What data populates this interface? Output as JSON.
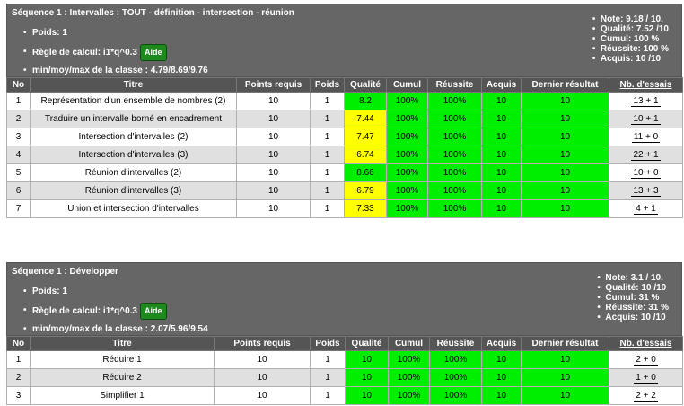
{
  "table_headers": {
    "no": "No",
    "titre": "Titre",
    "points_requis": "Points requis",
    "poids": "Poids",
    "qualite": "Qualité",
    "cumul": "Cumul",
    "reussite": "Réussite",
    "acquis": "Acquis",
    "dernier_resultat": "Dernier résultat",
    "nb_essais": "Nb. d'essais"
  },
  "sections": [
    {
      "title": "Séquence 1  : Intervalles : TOUT - définition - intersection - réunion",
      "poids_label": "Poids: 1",
      "regle_label": "Règle de calcul: i1*q^0.3",
      "aide_label": "Aide",
      "minmax_label": "min/moy/max de la classe : 4.79/8.69/9.76",
      "stats": {
        "note": "Note: 9.18 / 10.",
        "qualite": "Qualité: 7.52 /10",
        "cumul": "Cumul: 100 %",
        "reussite": "Réussite: 100 %",
        "acquis": "Acquis: 10 /10"
      },
      "rows": [
        {
          "no": "1",
          "titre": "Représentation d'un ensemble de nombres (2)",
          "points": "10",
          "poids": "1",
          "qualite": "8.2",
          "qcolor": "#00ee00",
          "cumul": "100%",
          "reussite": "100%",
          "acquis": "10",
          "dernier": "10",
          "essais": "13 + 1"
        },
        {
          "no": "2",
          "titre": "Traduire un intervalle borné en encadrement",
          "points": "10",
          "poids": "1",
          "qualite": "7.44",
          "qcolor": "#ffff00",
          "cumul": "100%",
          "reussite": "100%",
          "acquis": "10",
          "dernier": "10",
          "essais": "10 + 1"
        },
        {
          "no": "3",
          "titre": "Intersection d'intervalles (2)",
          "points": "10",
          "poids": "1",
          "qualite": "7.47",
          "qcolor": "#ffff00",
          "cumul": "100%",
          "reussite": "100%",
          "acquis": "10",
          "dernier": "10",
          "essais": "11 + 0"
        },
        {
          "no": "4",
          "titre": "Intersection d'intervalles (3)",
          "points": "10",
          "poids": "1",
          "qualite": "6.74",
          "qcolor": "#ffff00",
          "cumul": "100%",
          "reussite": "100%",
          "acquis": "10",
          "dernier": "10",
          "essais": "22 + 1"
        },
        {
          "no": "5",
          "titre": "Réunion d'intervalles (2)",
          "points": "10",
          "poids": "1",
          "qualite": "8.66",
          "qcolor": "#00ee00",
          "cumul": "100%",
          "reussite": "100%",
          "acquis": "10",
          "dernier": "10",
          "essais": "10 + 0"
        },
        {
          "no": "6",
          "titre": "Réunion d'intervalles (3)",
          "points": "10",
          "poids": "1",
          "qualite": "6.79",
          "qcolor": "#ffff00",
          "cumul": "100%",
          "reussite": "100%",
          "acquis": "10",
          "dernier": "10",
          "essais": "13 + 3"
        },
        {
          "no": "7",
          "titre": "Union et intersection d'intervalles",
          "points": "10",
          "poids": "1",
          "qualite": "7.33",
          "qcolor": "#ffff00",
          "cumul": "100%",
          "reussite": "100%",
          "acquis": "10",
          "dernier": "10",
          "essais": "4 + 1"
        }
      ]
    },
    {
      "title": "Séquence 1  : Développer",
      "poids_label": "Poids: 1",
      "regle_label": "Règle de calcul: i1*q^0.3",
      "aide_label": "Aide",
      "minmax_label": "min/moy/max de la classe : 2.07/5.96/9.54",
      "stats": {
        "note": "Note: 3.1 / 10.",
        "qualite": "Qualité: 10 /10",
        "cumul": "Cumul: 31 %",
        "reussite": "Réussite: 31 %",
        "acquis": "Acquis: 10 /10"
      },
      "rows": [
        {
          "no": "1",
          "titre": "Réduire 1",
          "points": "10",
          "poids": "1",
          "qualite": "10",
          "qcolor": "#00ee00",
          "cumul": "100%",
          "reussite": "100%",
          "acquis": "10",
          "dernier": "10",
          "essais": "2 + 0"
        },
        {
          "no": "2",
          "titre": "Réduire 2",
          "points": "10",
          "poids": "1",
          "qualite": "10",
          "qcolor": "#00ee00",
          "cumul": "100%",
          "reussite": "100%",
          "acquis": "10",
          "dernier": "10",
          "essais": "1 + 0"
        },
        {
          "no": "3",
          "titre": "Simplifier 1",
          "points": "10",
          "poids": "1",
          "qualite": "10",
          "qcolor": "#00ee00",
          "cumul": "100%",
          "reussite": "100%",
          "acquis": "10",
          "dernier": "10",
          "essais": "2 + 2"
        }
      ]
    }
  ],
  "colors": {
    "green": "#00ee00",
    "yellow": "#ffff00",
    "header": "#555555",
    "panel": "#666666"
  }
}
